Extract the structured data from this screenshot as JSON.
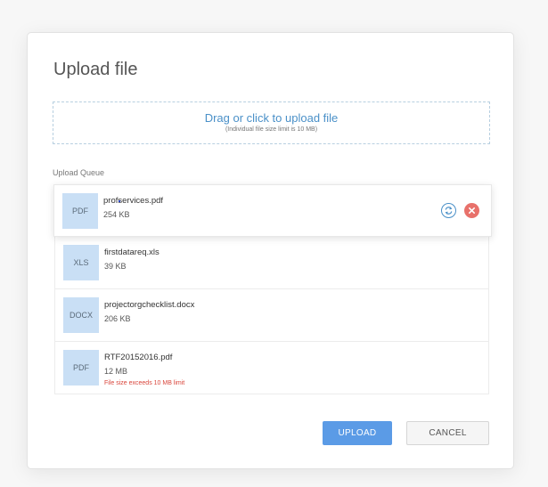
{
  "dialog": {
    "title": "Upload file",
    "dropzone": {
      "main_text": "Drag or click to upload file",
      "sub_text": "(Individual file size limit is 10 MB)"
    },
    "queue_label": "Upload Queue",
    "files": [
      {
        "type": "PDF",
        "name": "profservices.pdf",
        "size": "254 KB",
        "error": ""
      },
      {
        "type": "XLS",
        "name": "firstdatareq.xls",
        "size": "39 KB",
        "error": ""
      },
      {
        "type": "DOCX",
        "name": "projectorgchecklist.docx",
        "size": "206 KB",
        "error": ""
      },
      {
        "type": "PDF",
        "name": "RTF20152016.pdf",
        "size": "12 MB",
        "error": "File size exceeds 10 MB limit"
      }
    ],
    "buttons": {
      "upload": "UPLOAD",
      "cancel": "CANCEL"
    }
  },
  "colors": {
    "accent": "#4a90c8",
    "upload_button": "#5b9be6",
    "error": "#d9453b",
    "remove_icon": "#e8716b",
    "thumbnail": "#c9dff5"
  },
  "icons": [
    "replace-icon",
    "remove-icon"
  ]
}
